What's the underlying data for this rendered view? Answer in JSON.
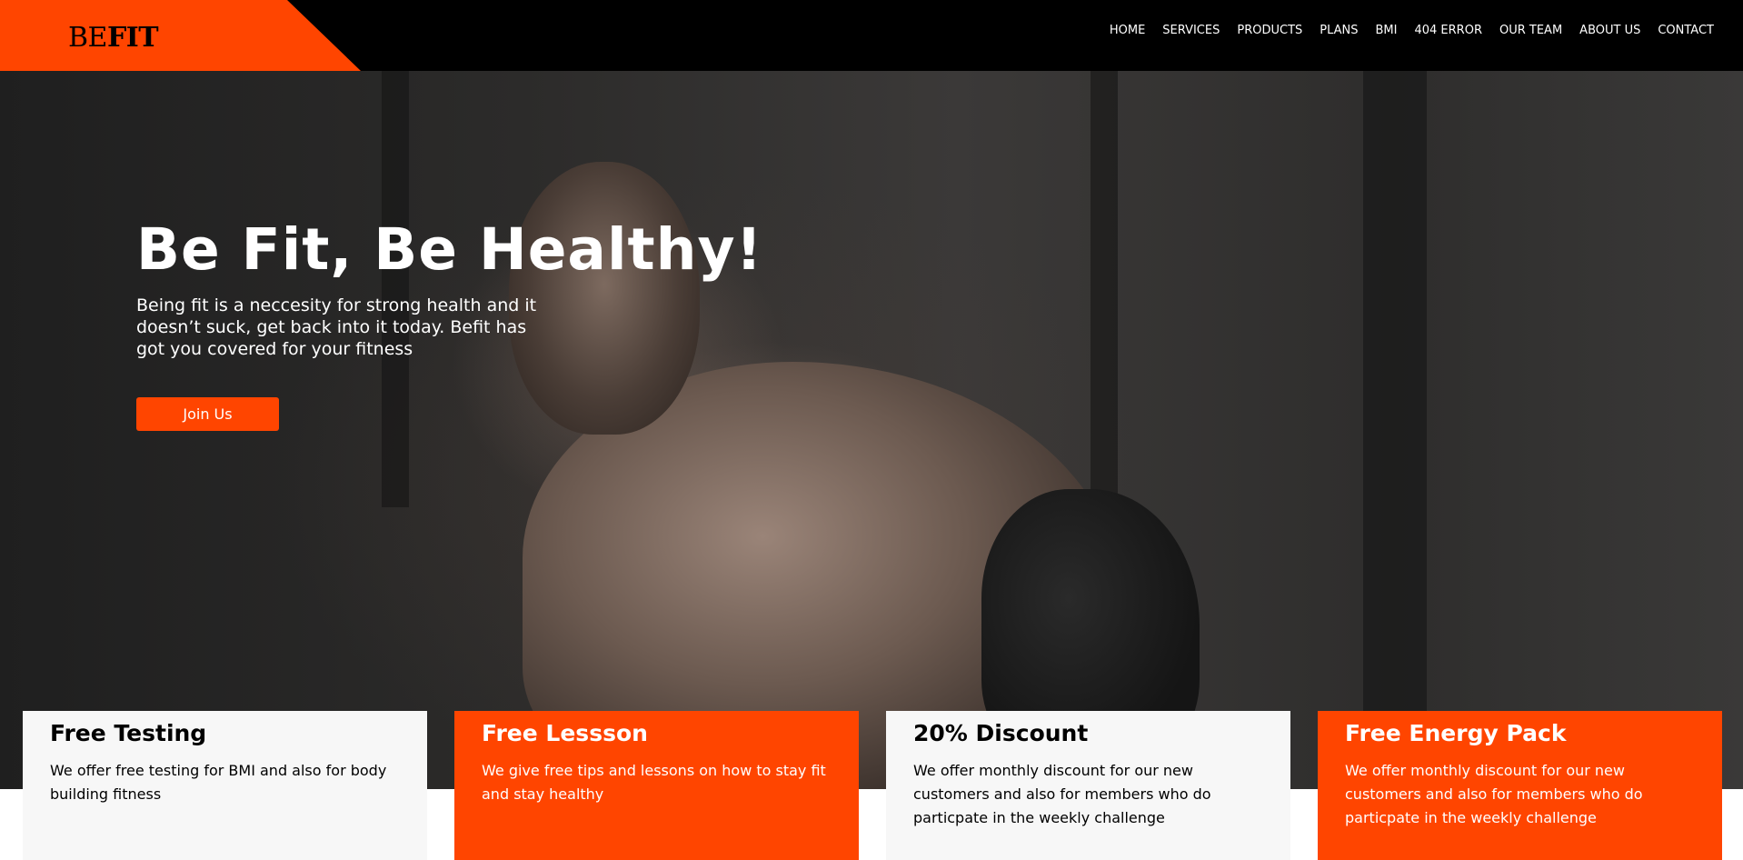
{
  "brand": {
    "logo_light": "BE",
    "logo_bold": "FIT",
    "accent": "#ff4500"
  },
  "nav": {
    "items": [
      "HOME",
      "SERVICES",
      "PRODUCTS",
      "PLANS",
      "BMI",
      "404 ERROR",
      "OUR TEAM",
      "ABOUT US",
      "CONTACT"
    ]
  },
  "hero": {
    "title": "Be Fit, Be Healthy!",
    "text": "Being fit is a neccesity for strong health and it doesn’t suck, get back into it today. Befit has got you covered for your fitness",
    "button": "Join Us"
  },
  "features": [
    {
      "title": "Free Testing",
      "text": "We offer free testing for BMI and also for body building fitness"
    },
    {
      "title": "Free Lessson",
      "text": "We give free tips and lessons on how to stay fit and stay healthy"
    },
    {
      "title": "20% Discount",
      "text": "We offer monthly discount for our new customers and also for members who do particpate in the weekly challenge"
    },
    {
      "title": "Free Energy Pack",
      "text": "We offer monthly discount for our new customers and also for members who do particpate in the weekly challenge"
    }
  ]
}
